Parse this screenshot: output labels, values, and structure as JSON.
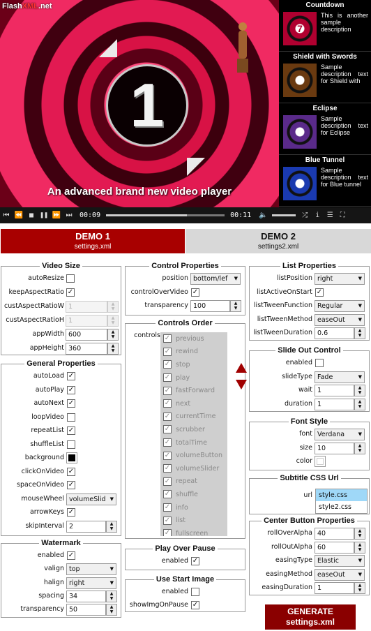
{
  "brand": {
    "flash": "Flash",
    "xml": "XML",
    "net": ".net"
  },
  "video": {
    "number": "1",
    "caption": "An advanced brand new video player"
  },
  "playlist": [
    {
      "title": "Countdown",
      "desc": "This is another sample description",
      "thumb_color": "#b00030"
    },
    {
      "title": "Shield with Swords",
      "desc": "Sample description text for Shield with",
      "thumb_color": "#6a3a10"
    },
    {
      "title": "Eclipse",
      "desc": "Sample description text for Eclipse",
      "thumb_color": "#5a2a8a"
    },
    {
      "title": "Blue Tunnel",
      "desc": "Sample description text for Blue tunnel",
      "thumb_color": "#1a3ab0"
    }
  ],
  "controls": {
    "current": "00:09",
    "total": "00:11",
    "progress": 0.68,
    "volume": 1.0
  },
  "tabs": [
    {
      "title": "DEMO 1",
      "file": "settings.xml"
    },
    {
      "title": "DEMO 2",
      "file": "settings2.xml"
    }
  ],
  "video_size": {
    "title": "Video Size",
    "labels": {
      "auto_resize": "autoResize",
      "keep": "keepAspectRatio",
      "w": "custAspectRatioW",
      "h": "custAspectRatioH",
      "aw": "appWidth",
      "ah": "appHeight"
    },
    "values": {
      "auto_resize": false,
      "keep": true,
      "w": "1",
      "h": "1",
      "aw": "600",
      "ah": "360"
    }
  },
  "general": {
    "title": "General Properties",
    "items": [
      {
        "label": "autoLoad",
        "type": "check",
        "checked": true
      },
      {
        "label": "autoPlay",
        "type": "check",
        "checked": true
      },
      {
        "label": "autoNext",
        "type": "check",
        "checked": true
      },
      {
        "label": "loopVideo",
        "type": "check",
        "checked": false
      },
      {
        "label": "repeatList",
        "type": "check",
        "checked": true
      },
      {
        "label": "shuffleList",
        "type": "check",
        "checked": false
      },
      {
        "label": "background",
        "type": "color",
        "color": "#000000"
      },
      {
        "label": "clickOnVideo",
        "type": "check",
        "checked": true
      },
      {
        "label": "spaceOnVideo",
        "type": "check",
        "checked": true
      },
      {
        "label": "mouseWheel",
        "type": "select",
        "value": "volumeSlid"
      },
      {
        "label": "arrowKeys",
        "type": "check",
        "checked": true
      },
      {
        "label": "skipInterval",
        "type": "num",
        "value": "2"
      }
    ]
  },
  "watermark": {
    "title": "Watermark",
    "items": [
      {
        "label": "enabled",
        "type": "check",
        "checked": true
      },
      {
        "label": "valign",
        "type": "select",
        "value": "top"
      },
      {
        "label": "halign",
        "type": "select",
        "value": "right"
      },
      {
        "label": "spacing",
        "type": "num",
        "value": "34"
      },
      {
        "label": "transparency",
        "type": "num",
        "value": "50"
      }
    ]
  },
  "control_props": {
    "title": "Control Properties",
    "items": [
      {
        "label": "position",
        "type": "select",
        "value": "bottom/lef"
      },
      {
        "label": "controlOverVideo",
        "type": "check",
        "checked": true
      },
      {
        "label": "transparency",
        "type": "num",
        "value": "100"
      }
    ]
  },
  "controls_order": {
    "title": "Controls Order",
    "label": "controls",
    "items": [
      "previous",
      "rewind",
      "stop",
      "play",
      "fastForward",
      "next",
      "currentTime",
      "scrubber",
      "totalTime",
      "volumeButton",
      "volumeSlider",
      "repeat",
      "shuffle",
      "info",
      "list",
      "fullscreen"
    ]
  },
  "play_over_pause": {
    "title": "Play Over Pause",
    "items": [
      {
        "label": "enabled",
        "type": "check",
        "checked": true
      }
    ]
  },
  "start_image": {
    "title": "Use Start Image",
    "items": [
      {
        "label": "enabled",
        "type": "check",
        "checked": false
      },
      {
        "label": "showImgOnPause",
        "type": "check",
        "checked": true
      }
    ]
  },
  "list_props": {
    "title": "List Properties",
    "items": [
      {
        "label": "listPosition",
        "type": "select",
        "value": "right"
      },
      {
        "label": "listActiveOnStart",
        "type": "check",
        "checked": true
      },
      {
        "label": "listTweenFunction",
        "type": "select",
        "value": "Regular"
      },
      {
        "label": "listTweenMethod",
        "type": "select",
        "value": "easeOut"
      },
      {
        "label": "listTweenDuration",
        "type": "num",
        "value": "0.6"
      }
    ]
  },
  "slide_out": {
    "title": "Slide Out Control",
    "items": [
      {
        "label": "enabled",
        "type": "check",
        "checked": false
      },
      {
        "label": "slideType",
        "type": "select",
        "value": "Fade"
      },
      {
        "label": "wait",
        "type": "num",
        "value": "1"
      },
      {
        "label": "duration",
        "type": "num",
        "value": "1"
      }
    ]
  },
  "font_style": {
    "title": "Font Style",
    "items": [
      {
        "label": "font",
        "type": "select",
        "value": "Verdana"
      },
      {
        "label": "size",
        "type": "num",
        "value": "10"
      },
      {
        "label": "color",
        "type": "color",
        "color": "#ffffff"
      }
    ]
  },
  "subtitle": {
    "title": "Subtitle CSS Url",
    "label": "url",
    "items": [
      "style.css",
      "style2.css"
    ]
  },
  "center_button": {
    "title": "Center Button Properties",
    "items": [
      {
        "label": "rollOverAlpha",
        "type": "num",
        "value": "40"
      },
      {
        "label": "rollOutAlpha",
        "type": "num",
        "value": "60"
      },
      {
        "label": "easingType",
        "type": "select",
        "value": "Elastic"
      },
      {
        "label": "easingMethod",
        "type": "select",
        "value": "easeOut"
      },
      {
        "label": "easingDuration",
        "type": "num",
        "value": "1"
      }
    ]
  },
  "generate": {
    "line1": "GENERATE",
    "line2": "settings.xml"
  }
}
